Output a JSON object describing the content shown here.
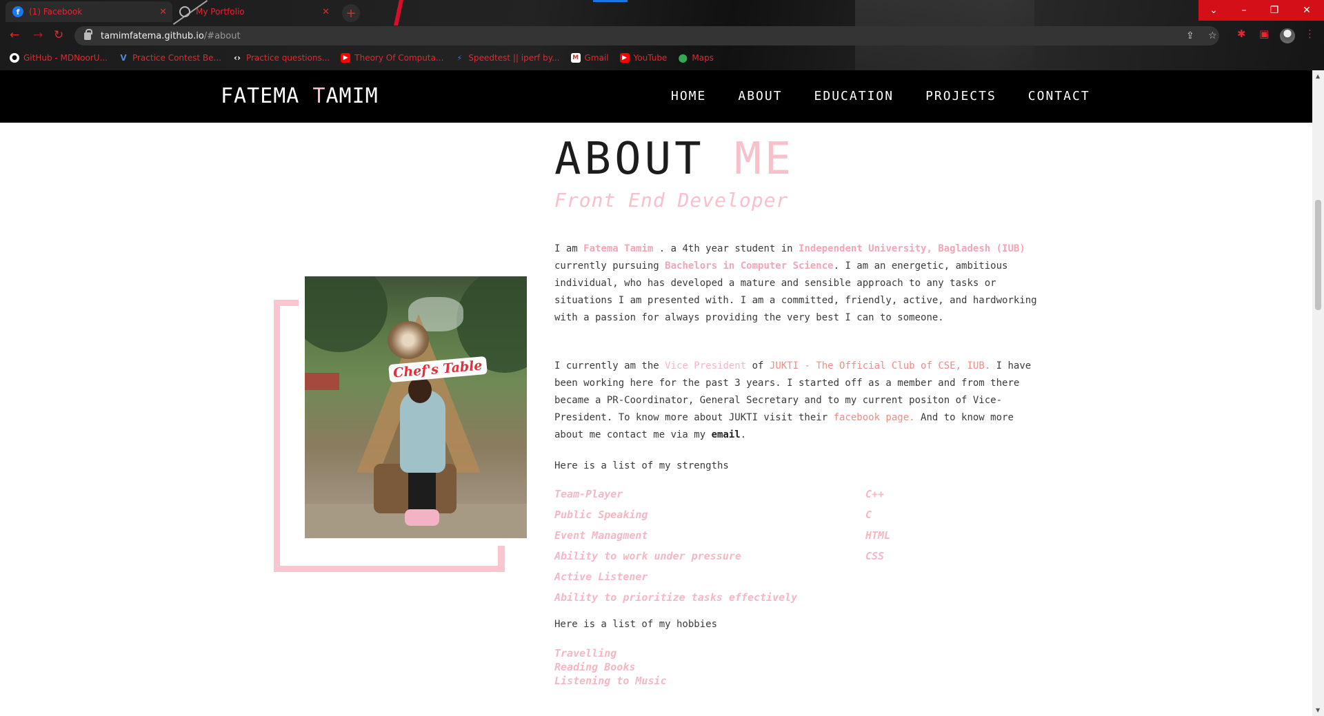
{
  "browser": {
    "tabs": [
      {
        "title": "(1) Facebook",
        "icon": "facebook-icon",
        "active": true
      },
      {
        "title": "My Portfolio",
        "icon": "globe-icon",
        "active": false
      }
    ],
    "url_host": "tamimfatema.github.io",
    "url_path": "/#about",
    "bookmarks": [
      {
        "label": "GitHub - MDNoorU...",
        "icon": "github-icon",
        "color": "#ffffff"
      },
      {
        "label": "Practice Contest Be...",
        "icon": "v-icon",
        "color": "#4a8bd6"
      },
      {
        "label": "Practice questions...",
        "icon": "code-icon",
        "color": "#ffffff"
      },
      {
        "label": "Theory Of Computa...",
        "icon": "youtube-icon",
        "color": "#ff0000"
      },
      {
        "label": "Speedtest || iperf by...",
        "icon": "speedtest-icon",
        "color": "#2c7be5"
      },
      {
        "label": "Gmail",
        "icon": "gmail-icon",
        "color": "#ffffff"
      },
      {
        "label": "YouTube",
        "icon": "youtube-icon",
        "color": "#ff0000"
      },
      {
        "label": "Maps",
        "icon": "maps-icon",
        "color": "#34a853"
      }
    ],
    "accent_color": "#e8262e"
  },
  "site": {
    "brand_first": "FATEMA ",
    "brand_accent": "T",
    "brand_rest": "AMIM",
    "nav": [
      "HOME",
      "ABOUT",
      "EDUCATION",
      "PROJECTS",
      "CONTACT"
    ]
  },
  "about": {
    "title_main": "ABOUT ",
    "title_accent": "ME",
    "subtitle": "Front End Developer",
    "p1": {
      "t1": "I am ",
      "name": "Fatema Tamim",
      "t2": " . a 4th year student in ",
      "uni": "Independent University, Bagladesh (IUB)",
      "t3": " currently pursuing ",
      "degree": "Bachelors in Computer Science",
      "t4": ". I am an energetic, ambitious individual, who has developed a mature and sensible approach to any tasks or situations I am presented with. I am a committed, friendly, active, and hardworking with a passion for always providing the very best I can to someone."
    },
    "p2": {
      "t1": "I currently am the ",
      "role": "Vice President",
      "t2": " of ",
      "club": "JUKTI - The Official Club of CSE, IUB.",
      "t3": " I have been working here for the past 3 years. I started off as a member and from there became a PR-Coordinator, General Secretary and to my current positon of Vice-President. To know more about JUKTI visit their ",
      "fb": "facebook page.",
      "t4": " And to know more about me contact me via my ",
      "email": "email",
      "t5": "."
    },
    "strengths_intro": "Here is a list of my strengths",
    "strengths": [
      "Team-Player",
      "Public Speaking",
      "Event Managment",
      "Ability to work under pressure",
      "Active Listener",
      "Ability to prioritize tasks effectively"
    ],
    "skills": [
      "C++",
      "C",
      "HTML",
      "CSS"
    ],
    "hobbies_intro": "Here is a list of my hobbies",
    "hobbies": [
      "Travelling",
      "Reading Books",
      "Listening to Music"
    ],
    "photo_sign": "Chef's Table",
    "accent_pink": "#f7c0cb"
  }
}
